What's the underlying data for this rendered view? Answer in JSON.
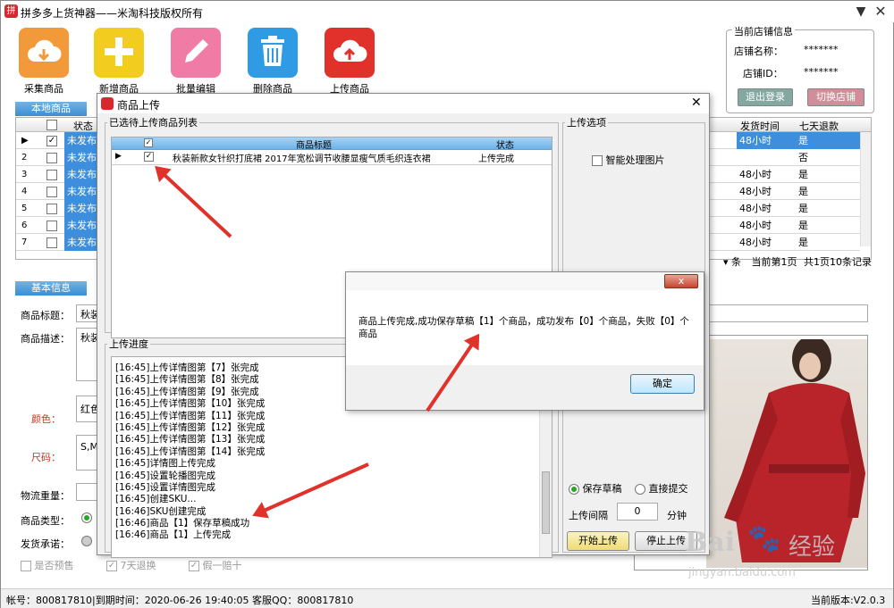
{
  "app": {
    "title": "拼多多上货神器——米淘科技版权所有",
    "logo_glyph": "拼"
  },
  "toolbar": [
    {
      "label": "采集商品",
      "icon": "cloud-download-icon",
      "color": "#f29a3a"
    },
    {
      "label": "新增商品",
      "icon": "plus-icon",
      "color": "#f2cc1e"
    },
    {
      "label": "批量编辑",
      "icon": "pencil-icon",
      "color": "#f07ba5"
    },
    {
      "label": "删除商品",
      "icon": "trash-icon",
      "color": "#2f9be4"
    },
    {
      "label": "上传商品",
      "icon": "cloud-upload-icon",
      "color": "#e0312b"
    }
  ],
  "shop": {
    "legend": "当前店铺信息",
    "name_label": "店铺名称：",
    "name_value": "*******",
    "id_label": "店铺ID：",
    "id_value": "*******",
    "logout": "退出登录",
    "switch": "切换店铺"
  },
  "local_tab": "本地商品",
  "main_grid": {
    "status_header": "状态",
    "rows": [
      {
        "num": "1",
        "status": "未发布",
        "checked": true
      },
      {
        "num": "2",
        "status": "未发布"
      },
      {
        "num": "3",
        "status": "未发布"
      },
      {
        "num": "4",
        "status": "未发布"
      },
      {
        "num": "5",
        "status": "未发布"
      },
      {
        "num": "6",
        "status": "未发布"
      },
      {
        "num": "7",
        "status": "未发布"
      }
    ]
  },
  "right_grid": {
    "headers": [
      "发货时间",
      "七天退款"
    ],
    "rows": [
      [
        "48小时",
        "是"
      ],
      [
        "",
        "否"
      ],
      [
        "48小时",
        "是"
      ],
      [
        "48小时",
        "是"
      ],
      [
        "48小时",
        "是"
      ],
      [
        "48小时",
        "是"
      ],
      [
        "48小时",
        "是"
      ]
    ]
  },
  "pager": {
    "unit": "条",
    "page": "当前第1页",
    "total": "共1页10条记录"
  },
  "basic_tab": "基本信息",
  "form": {
    "title_label": "商品标题：",
    "title_value": "秋装",
    "desc_label": "商品描述：",
    "desc_value": "秋装",
    "color_label": "颜色：",
    "color_value": "红色",
    "size_label": "尺码：",
    "size_value": "S,M",
    "weight_label": "物流重量：",
    "type_label": "商品类型：",
    "promise_label": "发货承诺：",
    "presale": "是否预售",
    "seven_day": "7天退换",
    "fake_refund": "假一赔十"
  },
  "status_bar": {
    "left": "帐号：800817810|到期时间：2020-06-26 19:40:05  客服QQ：800817810",
    "right": "当前版本:V2.0.3"
  },
  "upload_dialog": {
    "title": "商品上传",
    "list_legend": "已选待上传商品列表",
    "col_title": "商品标题",
    "col_status": "状态",
    "item": {
      "title": "秋装新款女针织打底裙 2017年宽松调节收腰显瘦气质毛织连衣裙",
      "status": "上传完成"
    },
    "options_legend": "上传选项",
    "smart_image": "智能处理图片",
    "progress_legend": "上传进度",
    "log": [
      "[16:45]上传详情图第【7】张完成",
      "[16:45]上传详情图第【8】张完成",
      "[16:45]上传详情图第【9】张完成",
      "[16:45]上传详情图第【10】张完成",
      "[16:45]上传详情图第【11】张完成",
      "[16:45]上传详情图第【12】张完成",
      "[16:45]上传详情图第【13】张完成",
      "[16:45]上传详情图第【14】张完成",
      "[16:45]详情图上传完成",
      "[16:45]设置轮播图完成",
      "[16:45]设置详情图完成",
      "[16:45]创建SKU...",
      "[16:46]SKU创建完成",
      "[16:46]商品【1】保存草稿成功",
      "[16:46]商品【1】上传完成"
    ],
    "save_draft": "保存草稿",
    "direct_submit": "直接提交",
    "interval_label": "上传间隔",
    "interval_value": "0",
    "interval_unit": "分钟",
    "start": "开始上传",
    "stop": "停止上传"
  },
  "message_box": {
    "text": "商品上传完成,成功保存草稿【1】个商品，成功发布【0】个商品，失败【0】个商品",
    "ok": "确定"
  },
  "watermark": {
    "brand": "Bai",
    "brand2": "经验",
    "url": "jingyan.baidu.com"
  }
}
